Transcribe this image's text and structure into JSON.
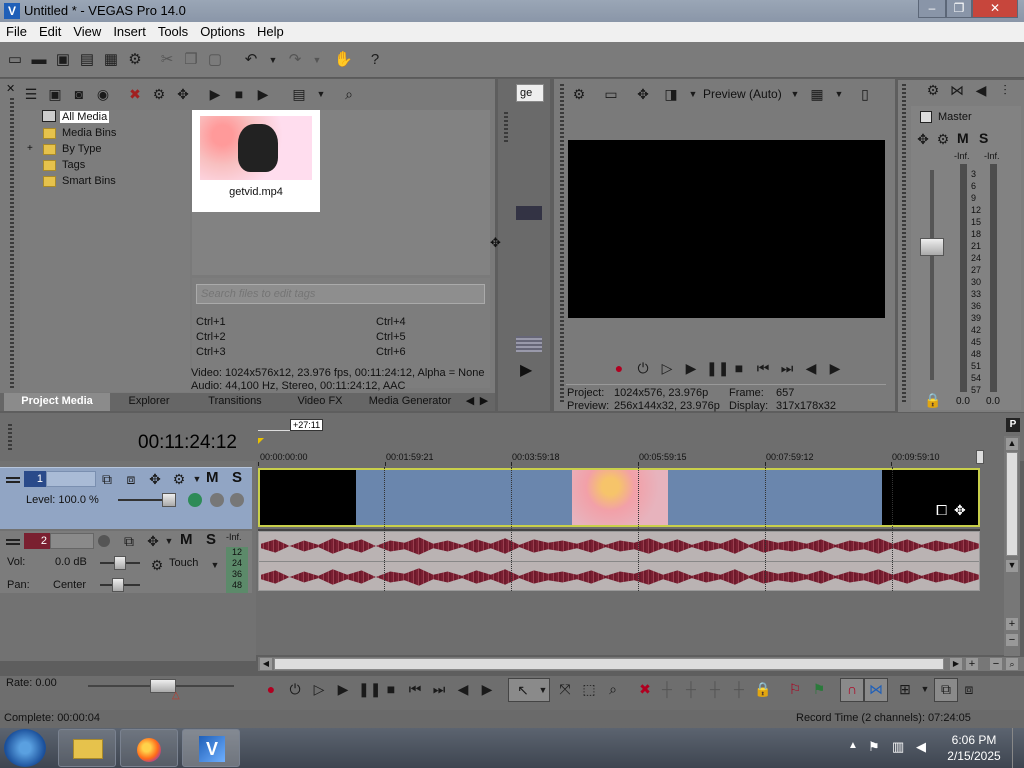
{
  "window": {
    "title": "Untitled * - VEGAS Pro 14.0",
    "minimize": "–",
    "restore": "❐",
    "close": "✕"
  },
  "menu": [
    "File",
    "Edit",
    "View",
    "Insert",
    "Tools",
    "Options",
    "Help"
  ],
  "project_media": {
    "tree": [
      {
        "label": "All Media",
        "selected": true
      },
      {
        "label": "Media Bins"
      },
      {
        "label": "By Type",
        "expander": "+"
      },
      {
        "label": "Tags"
      },
      {
        "label": "Smart Bins"
      }
    ],
    "file": {
      "name": "getvid.mp4"
    },
    "tag_search_placeholder": "Search files to edit tags",
    "shortcuts": [
      "Ctrl+1",
      "Ctrl+2",
      "Ctrl+3",
      "Ctrl+4",
      "Ctrl+5",
      "Ctrl+6"
    ],
    "info_video": "Video: 1024x576x12, 23.976 fps, 00:11:24:12, Alpha = None",
    "info_audio": "Audio: 44,100 Hz, Stereo, 00:11:24:12, AAC"
  },
  "tabs": [
    "Project Media",
    "Explorer",
    "Transitions",
    "Video FX",
    "Media Generator"
  ],
  "trimmer_dropdown": "ge",
  "preview": {
    "mode": "Preview (Auto)",
    "project_label": "Project:",
    "project_value": "1024x576, 23.976p",
    "preview_label": "Preview:",
    "preview_value": "256x144x32, 23.976p",
    "frame_label": "Frame:",
    "frame_value": "657",
    "display_label": "Display:",
    "display_value": "317x178x32"
  },
  "master": {
    "title": "Master",
    "m": "M",
    "s": "S",
    "left_inf": "-Inf.",
    "right_inf": "-Inf.",
    "scale": [
      "3",
      "6",
      "9",
      "12",
      "15",
      "18",
      "21",
      "24",
      "27",
      "30",
      "33",
      "36",
      "39",
      "42",
      "45",
      "48",
      "51",
      "54",
      "57"
    ],
    "left_value": "0.0",
    "right_value": "0.0"
  },
  "timeline": {
    "time": "00:11:24:12",
    "marker": "+27:11",
    "ruler": [
      "00:00:00:00",
      "00:01:59:21",
      "00:03:59:18",
      "00:05:59:15",
      "00:07:59:12",
      "00:09:59:10"
    ],
    "track1": {
      "number": "1",
      "level": "Level: 100.0 %",
      "m": "M",
      "s": "S"
    },
    "track2": {
      "number": "2",
      "vol_label": "Vol:",
      "vol_value": "0.0 dB",
      "pan_label": "Pan:",
      "pan_value": "Center",
      "automation": "Touch",
      "m": "M",
      "s": "S",
      "meter": [
        "-Inf.",
        "12",
        "24",
        "36",
        "48"
      ]
    },
    "rate": "Rate: 0.00"
  },
  "status": {
    "complete": "Complete: 00:00:04",
    "record_time": "Record Time (2 channels): 07:24:05"
  },
  "taskbar": {
    "time": "6:06 PM",
    "date": "2/15/2025"
  },
  "colors": {
    "accent": "#1f5fb8",
    "track_selected": "#91a5c4",
    "video_event": "#6a86ad",
    "audio_wave": "#7a1f32",
    "event_border": "#c8cf4a"
  }
}
